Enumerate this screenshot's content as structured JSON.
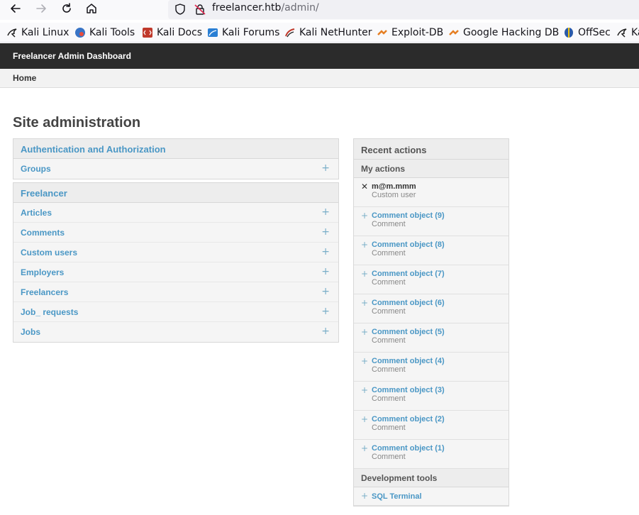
{
  "browser": {
    "url_host": "freelancer.htb",
    "url_path": "/admin/",
    "bookmarks": [
      {
        "label": "Kali Linux",
        "icon": "kali-dragon-icon"
      },
      {
        "label": "Kali Tools",
        "icon": "kali-tools-icon"
      },
      {
        "label": "Kali Docs",
        "icon": "kali-docs-icon"
      },
      {
        "label": "Kali Forums",
        "icon": "kali-forums-icon"
      },
      {
        "label": "Kali NetHunter",
        "icon": "kali-nethunter-icon"
      },
      {
        "label": "Exploit-DB",
        "icon": "exploit-db-icon"
      },
      {
        "label": "Google Hacking DB",
        "icon": "ghdb-icon"
      },
      {
        "label": "OffSec",
        "icon": "offsec-icon"
      },
      {
        "label": "Ka",
        "icon": "kali-dragon-icon"
      }
    ]
  },
  "header": {
    "brand": "Freelancer Admin Dashboard"
  },
  "breadcrumb": {
    "home": "Home"
  },
  "page": {
    "title": "Site administration"
  },
  "apps": [
    {
      "caption": "Authentication and Authorization",
      "models": [
        "Groups"
      ]
    },
    {
      "caption": "Freelancer",
      "models": [
        "Articles",
        "Comments",
        "Custom users",
        "Employers",
        "Freelancers",
        "Job_ requests",
        "Jobs"
      ]
    }
  ],
  "recent": {
    "caption": "Recent actions",
    "my_actions": "My actions",
    "items": [
      {
        "title": "m@m.mmm",
        "kind": "Custom user",
        "action": "delete"
      },
      {
        "title": "Comment object (9)",
        "kind": "Comment",
        "action": "add"
      },
      {
        "title": "Comment object (8)",
        "kind": "Comment",
        "action": "add"
      },
      {
        "title": "Comment object (7)",
        "kind": "Comment",
        "action": "add"
      },
      {
        "title": "Comment object (6)",
        "kind": "Comment",
        "action": "add"
      },
      {
        "title": "Comment object (5)",
        "kind": "Comment",
        "action": "add"
      },
      {
        "title": "Comment object (4)",
        "kind": "Comment",
        "action": "add"
      },
      {
        "title": "Comment object (3)",
        "kind": "Comment",
        "action": "add"
      },
      {
        "title": "Comment object (2)",
        "kind": "Comment",
        "action": "add"
      },
      {
        "title": "Comment object (1)",
        "kind": "Comment",
        "action": "add"
      }
    ],
    "dev_tools": "Development tools",
    "sql_terminal": "SQL Terminal"
  },
  "colors": {
    "header_bg": "#2b2b2b",
    "link": "#4a97c5",
    "module_bg": "#f5f5f5"
  }
}
